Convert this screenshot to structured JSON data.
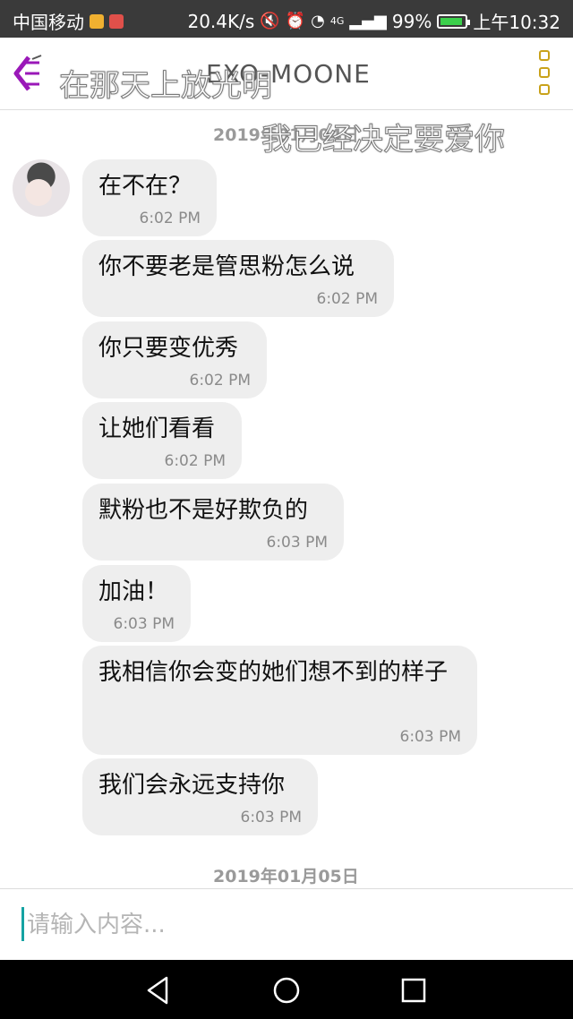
{
  "status": {
    "carrier": "中国移动",
    "speed": "20.4K/s",
    "signal_type": "4G",
    "battery": "99%",
    "time": "上午10:32",
    "icons": [
      "mute-icon",
      "alarm-icon",
      "wifi-icon",
      "signal-icon",
      "battery-icon"
    ]
  },
  "header": {
    "title": "EXO-MOONE",
    "overlay_text": "在那天上放光明",
    "back_icon": "back-icon",
    "menu_icon": "more-menu-icon"
  },
  "overlay_quote": "我已经决定要爱你",
  "dates": {
    "top": "2019年01月04日",
    "bottom": "2019年01月05日"
  },
  "messages": [
    {
      "text": "在不在？",
      "time": "6:02 PM"
    },
    {
      "text": "你不要老是管思粉怎么说",
      "time": "6:02 PM"
    },
    {
      "text": "你只要变优秀",
      "time": "6:02 PM"
    },
    {
      "text": "让她们看看",
      "time": "6:02 PM"
    },
    {
      "text": "默粉也不是好欺负的",
      "time": "6:03 PM"
    },
    {
      "text": "加油！",
      "time": "6:03 PM"
    },
    {
      "text": "我相信你会变的她们想不到的样子",
      "time": "6:03 PM"
    },
    {
      "text": "我们会永远支持你",
      "time": "6:03 PM"
    }
  ],
  "input": {
    "placeholder": "请输入内容..."
  },
  "colors": {
    "accent": "#15a3a3",
    "bubble": "#eeeeee",
    "menu": "#c9a21a",
    "back": "#9a18b8"
  }
}
